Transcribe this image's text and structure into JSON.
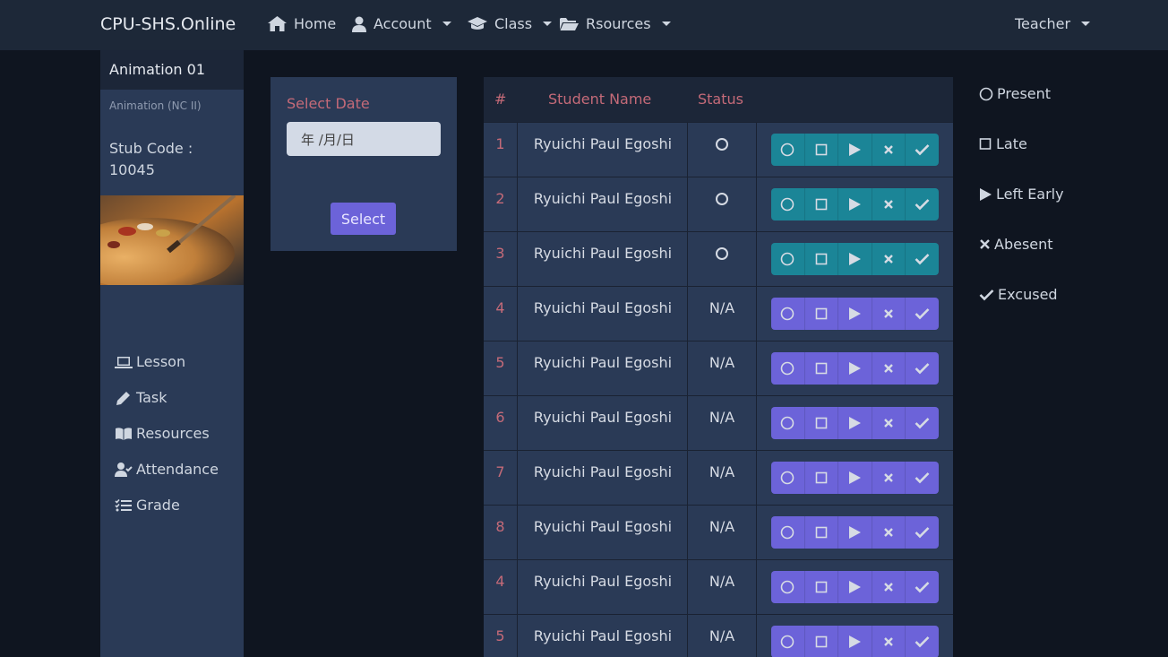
{
  "navbar": {
    "brand": "CPU-SHS.Online",
    "home": "Home",
    "account": "Account",
    "class": "Class",
    "resources": "Rsources",
    "user": "Teacher"
  },
  "sidebar": {
    "class_title": "Animation 01",
    "class_sub": "Animation (NC II)",
    "stub_code": "Stub Code : 10045",
    "links": [
      {
        "label": "Lesson",
        "icon": "laptop-icon"
      },
      {
        "label": "Task",
        "icon": "pencil-icon"
      },
      {
        "label": "Resources",
        "icon": "book-icon"
      },
      {
        "label": "Attendance",
        "icon": "user-check-icon"
      },
      {
        "label": "Grade",
        "icon": "list-check-icon"
      }
    ]
  },
  "date_card": {
    "label": "Select Date",
    "value": "年 /月/日",
    "button": "Select"
  },
  "table": {
    "headers": {
      "num": "#",
      "name": "Student Name",
      "status": "Status"
    },
    "rows": [
      {
        "num": "1",
        "name": "Ryuichi Paul Egoshi",
        "status": "present"
      },
      {
        "num": "2",
        "name": "Ryuichi Paul Egoshi",
        "status": "present"
      },
      {
        "num": "3",
        "name": "Ryuichi Paul Egoshi",
        "status": "present"
      },
      {
        "num": "4",
        "name": "Ryuichi Paul Egoshi",
        "status": "N/A"
      },
      {
        "num": "5",
        "name": "Ryuichi Paul Egoshi",
        "status": "N/A"
      },
      {
        "num": "6",
        "name": "Ryuichi Paul Egoshi",
        "status": "N/A"
      },
      {
        "num": "7",
        "name": "Ryuichi Paul Egoshi",
        "status": "N/A"
      },
      {
        "num": "8",
        "name": "Ryuichi Paul Egoshi",
        "status": "N/A"
      },
      {
        "num": "4",
        "name": "Ryuichi Paul Egoshi",
        "status": "N/A"
      },
      {
        "num": "5",
        "name": "Ryuichi Paul Egoshi",
        "status": "N/A"
      }
    ]
  },
  "legend": [
    {
      "label": "Present",
      "icon": "circle-icon"
    },
    {
      "label": "Late",
      "icon": "square-icon"
    },
    {
      "label": "Left Early",
      "icon": "play-icon"
    },
    {
      "label": "Abesent",
      "icon": "x-icon"
    },
    {
      "label": "Excused",
      "icon": "check-icon"
    }
  ],
  "colors": {
    "teal": "#1b8597",
    "purple": "#6c63d9",
    "accent_red": "#c46a78"
  }
}
